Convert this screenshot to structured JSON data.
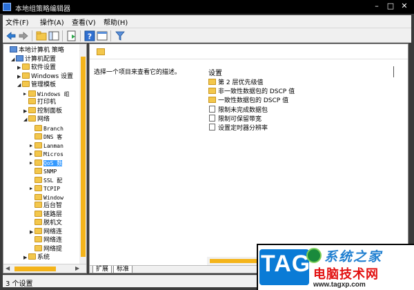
{
  "window": {
    "title": "本地组策略编辑器"
  },
  "menu": [
    {
      "label": "文件(F)"
    },
    {
      "label": "操作(A)"
    },
    {
      "label": "查看(V)"
    },
    {
      "label": "帮助(H)"
    }
  ],
  "tree": [
    {
      "label": "本地计算机 策略",
      "level": 0,
      "exp": "",
      "icon": "pc-icon",
      "mono": false
    },
    {
      "label": "计算机配置",
      "level": 1,
      "exp": "◢",
      "icon": "pc-icon",
      "mono": false
    },
    {
      "label": "软件设置",
      "level": 2,
      "exp": "▶",
      "icon": "folder-icon",
      "mono": false
    },
    {
      "label": "Windows 设置",
      "level": 2,
      "exp": "▶",
      "icon": "folder-icon",
      "mono": false
    },
    {
      "label": "管理模板",
      "level": 2,
      "exp": "◢",
      "icon": "folder-icon",
      "mono": false
    },
    {
      "label": "Windows 组",
      "level": 3,
      "exp": "▶",
      "icon": "folder-icon",
      "mono": true
    },
    {
      "label": "打印机",
      "level": 3,
      "exp": "",
      "icon": "folder-icon",
      "mono": false
    },
    {
      "label": "控制面板",
      "level": 3,
      "exp": "▶",
      "icon": "folder-icon",
      "mono": false
    },
    {
      "label": "网络",
      "level": 3,
      "exp": "◢",
      "icon": "folder-icon",
      "mono": false
    },
    {
      "label": "Branch",
      "level": 4,
      "exp": "",
      "icon": "folder-icon",
      "mono": true
    },
    {
      "label": "DNS 客",
      "level": 4,
      "exp": "",
      "icon": "folder-icon",
      "mono": true
    },
    {
      "label": "Lanman",
      "level": 4,
      "exp": "▶",
      "icon": "folder-icon",
      "mono": true
    },
    {
      "label": "Micros",
      "level": 4,
      "exp": "▶",
      "icon": "folder-icon",
      "mono": true
    },
    {
      "label": "QoS 数",
      "level": 4,
      "exp": "▶",
      "icon": "folder-icon",
      "mono": true,
      "selected": true
    },
    {
      "label": "SNMP",
      "level": 4,
      "exp": "",
      "icon": "folder-icon",
      "mono": true
    },
    {
      "label": "SSL 配",
      "level": 4,
      "exp": "",
      "icon": "folder-icon",
      "mono": true
    },
    {
      "label": "TCPIP",
      "level": 4,
      "exp": "▶",
      "icon": "folder-icon",
      "mono": true
    },
    {
      "label": "Window",
      "level": 4,
      "exp": "",
      "icon": "folder-icon",
      "mono": true
    },
    {
      "label": "后台智",
      "level": 4,
      "exp": "",
      "icon": "folder-icon",
      "mono": false
    },
    {
      "label": "链路层",
      "level": 4,
      "exp": "",
      "icon": "folder-icon",
      "mono": false
    },
    {
      "label": "脱机文",
      "level": 4,
      "exp": "",
      "icon": "folder-icon",
      "mono": false
    },
    {
      "label": "网络连",
      "level": 4,
      "exp": "▶",
      "icon": "folder-icon",
      "mono": false
    },
    {
      "label": "网络连",
      "level": 4,
      "exp": "",
      "icon": "folder-icon",
      "mono": false
    },
    {
      "label": "网络提",
      "level": 4,
      "exp": "",
      "icon": "folder-icon",
      "mono": false
    },
    {
      "label": "系统",
      "level": 3,
      "exp": "▶",
      "icon": "folder-icon",
      "mono": false
    }
  ],
  "right": {
    "description": "选择一个项目来查看它的描述。",
    "list_header": "设置",
    "items": [
      {
        "label": "第 2 层优先级值",
        "icon": "folder-icon"
      },
      {
        "label": "非一致性数据包的 DSCP 值",
        "icon": "folder-icon"
      },
      {
        "label": "一致性数据包的 DSCP 值",
        "icon": "folder-icon"
      },
      {
        "label": "限制未完成数据包",
        "icon": "setting-icon"
      },
      {
        "label": "限制可保留带宽",
        "icon": "setting-icon"
      },
      {
        "label": "设置定时器分辨率",
        "icon": "setting-icon"
      }
    ],
    "tabs": [
      {
        "label": "扩展"
      },
      {
        "label": "标准"
      }
    ]
  },
  "status": {
    "text": "3 个设置"
  },
  "watermark": {
    "tag": "TAG",
    "brand": "系统之家",
    "sub": "电脑技术网",
    "url": "www.tagxp.com"
  },
  "colors": {
    "accent": "#f4b41a",
    "selection": "#3399ff",
    "watermark_blue": "#0a7bd6",
    "watermark_red": "#e21010"
  }
}
